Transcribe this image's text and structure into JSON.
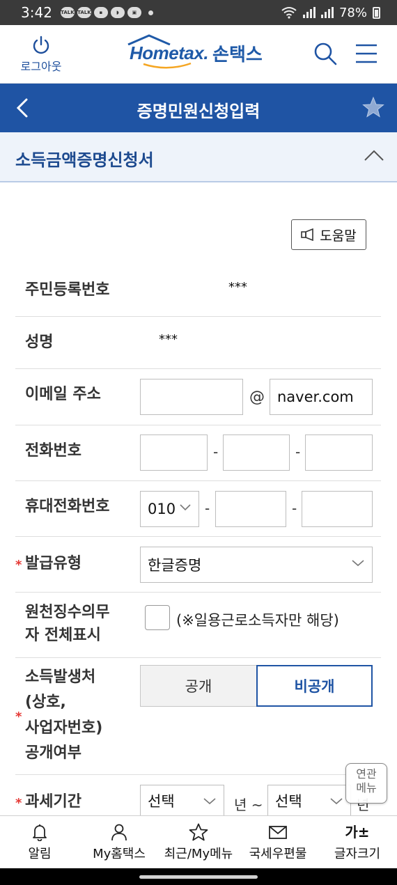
{
  "status_bar": {
    "time": "3:42",
    "notifications": [
      "TALK",
      "TALK"
    ],
    "battery": "78%"
  },
  "header": {
    "logout_label": "로그아웃",
    "brand_home": "Hometax.",
    "brand_son": "손택스"
  },
  "titlebar": {
    "title": "증명민원신청입력"
  },
  "section": {
    "title": "소득금액증명신청서"
  },
  "help": {
    "label": "도움말"
  },
  "form": {
    "resident_no": {
      "label": "주민등록번호",
      "value": "***"
    },
    "name": {
      "label": "성명",
      "value": "***"
    },
    "email": {
      "label": "이메일 주소",
      "local": "",
      "at": "@",
      "domain": "naver.com"
    },
    "phone": {
      "label": "전화번호",
      "sep": "-"
    },
    "mobile": {
      "label": "휴대전화번호",
      "prefix": "010",
      "sep": "-"
    },
    "issue_type": {
      "required": "*",
      "label": "발급유형",
      "value": "한글증명"
    },
    "withholding": {
      "label_line1": "원천징수의무",
      "label_line2": "자 전체표시",
      "note": "(※일용근로소득자만 해당)",
      "checked": false
    },
    "income_source": {
      "required": "*",
      "label_lines": [
        "소득발생처",
        "(상호,",
        "사업자번호)",
        "공개여부"
      ],
      "options": [
        "공개",
        "비공개"
      ],
      "selected": "비공개"
    },
    "tax_period": {
      "required": "*",
      "label": "과세기간",
      "start": "선택",
      "mid": "년 ~",
      "end": "선택",
      "tail": "년"
    }
  },
  "related_menu": {
    "line1": "연관",
    "line2": "메뉴"
  },
  "bottom_nav": [
    {
      "label": "알림",
      "icon": "bell-icon"
    },
    {
      "label": "My홈택스",
      "icon": "person-icon"
    },
    {
      "label": "최근/My메뉴",
      "icon": "star-outline-icon"
    },
    {
      "label": "국세우편물",
      "icon": "mail-icon"
    },
    {
      "label": "글자크기",
      "icon_text": "가±"
    }
  ]
}
